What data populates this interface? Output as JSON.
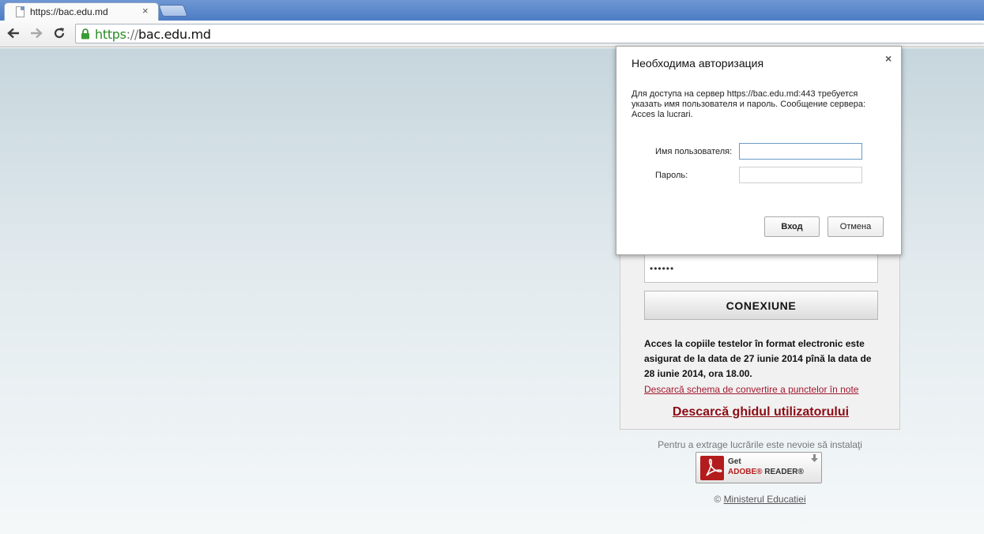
{
  "browser": {
    "tab_title": "https://bac.edu.md",
    "tab_close": "×",
    "url_scheme": "https",
    "url_separator": "://",
    "url_host": "bac.edu.md"
  },
  "login": {
    "password_value": "••••••",
    "submit_label": "CONEXIUNE",
    "info_text": "Acces la copiile testelor în format electronic este asigurat de la data de 27 iunie 2014 pînă la data de 28 iunie 2014, ora 18.00.",
    "schema_link": "Descarcă schema de convertire a punctelor în note",
    "guide_link": "Descarcă ghidul utilizatorului"
  },
  "footer": {
    "install_note": "Pentru a extrage lucrările este nevoie să instalaţi",
    "adobe_get": "Get",
    "adobe_brand": "ADOBE®",
    "adobe_product": "READER®",
    "copyright_symbol": "©",
    "copyright_link": "Ministerul Educatiei"
  },
  "dialog": {
    "title": "Необходима авторизация",
    "close": "×",
    "message": "Для доступа на сервер https://bac.edu.md:443 требуется указать имя пользователя и пароль. Сообщение сервера: Acces la lucrari.",
    "username_label": "Имя пользователя:",
    "password_label": "Пароль:",
    "username_value": "",
    "password_value": "",
    "login_button": "Вход",
    "cancel_button": "Отмена"
  },
  "colors": {
    "url_scheme": "#2a8a24",
    "link": "#a3182f",
    "guide_link": "#8c0c14",
    "adobe_red": "#b31c1c"
  }
}
